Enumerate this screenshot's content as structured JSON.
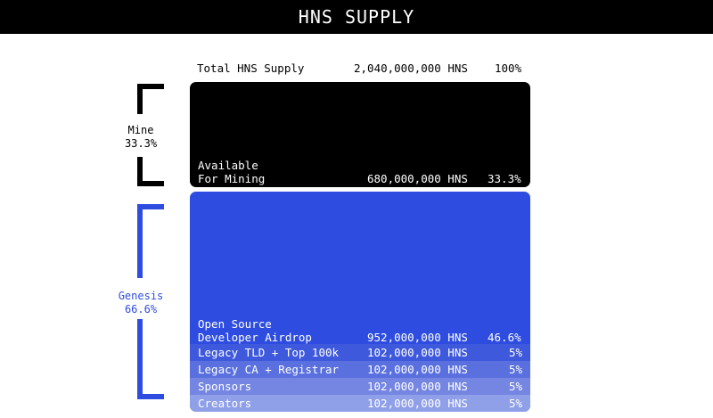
{
  "page": {
    "title": "HNS SUPPLY"
  },
  "total": {
    "label": "Total HNS Supply",
    "amount": "2,040,000,000 HNS",
    "percent": "100%"
  },
  "groups": {
    "mine": {
      "name": "Mine",
      "percent": "33.3%"
    },
    "genesis": {
      "name": "Genesis",
      "percent": "66.6%"
    }
  },
  "mine_block": {
    "label_line1": "Available",
    "label_line2": "For Mining",
    "amount": "680,000,000 HNS",
    "percent": "33.3%"
  },
  "genesis_block": {
    "airdrop": {
      "label_line1": "Open Source",
      "label_line2": "Developer Airdrop",
      "amount": "952,000,000 HNS",
      "percent": "46.6%"
    },
    "segments": [
      {
        "label": "Legacy TLD + Top 100k",
        "amount": "102,000,000 HNS",
        "percent": "5%",
        "color": "#3f59dc"
      },
      {
        "label": "Legacy CA + Registrar",
        "amount": "102,000,000 HNS",
        "percent": "5%",
        "color": "#5a70de"
      },
      {
        "label": "Sponsors",
        "amount": "102,000,000 HNS",
        "percent": "5%",
        "color": "#7586e2"
      },
      {
        "label": "Creators",
        "amount": "102,000,000 HNS",
        "percent": "5%",
        "color": "#8f9fe8"
      }
    ]
  },
  "colors": {
    "mine": "#000000",
    "genesis": "#2e4de0",
    "bracket_genesis": "#2e4de0"
  },
  "chart_data": {
    "type": "bar",
    "title": "HNS SUPPLY",
    "total": 2040000000,
    "categories": [
      "Available For Mining",
      "Open Source Developer Airdrop",
      "Legacy TLD + Top 100k",
      "Legacy CA + Registrar",
      "Sponsors",
      "Creators"
    ],
    "values": [
      680000000,
      952000000,
      102000000,
      102000000,
      102000000,
      102000000
    ],
    "percents": [
      33.3,
      46.6,
      5,
      5,
      5,
      5
    ],
    "groups": [
      {
        "name": "Mine",
        "percent": 33.3,
        "members": [
          "Available For Mining"
        ]
      },
      {
        "name": "Genesis",
        "percent": 66.6,
        "members": [
          "Open Source Developer Airdrop",
          "Legacy TLD + Top 100k",
          "Legacy CA + Registrar",
          "Sponsors",
          "Creators"
        ]
      }
    ]
  }
}
